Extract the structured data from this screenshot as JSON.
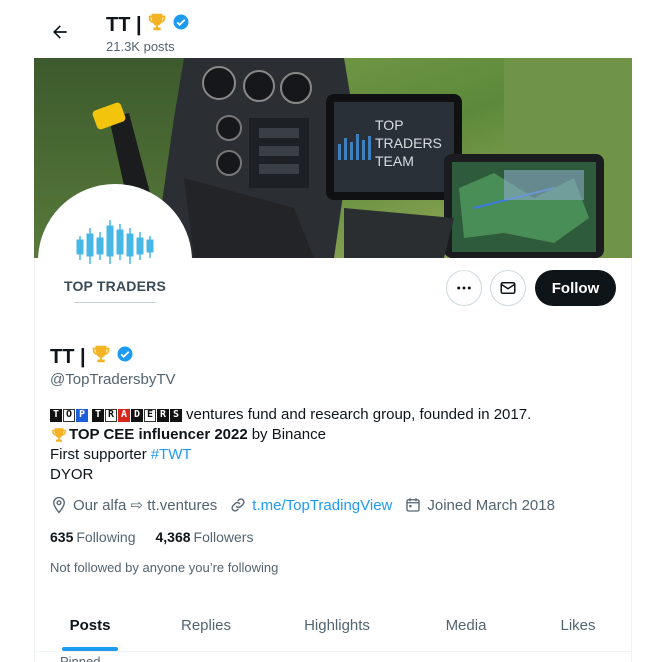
{
  "header": {
    "title": "TT |",
    "posts_count": "21.3K posts"
  },
  "banner": {
    "screen_text": [
      "TOP",
      "TRADERS",
      "TEAM"
    ]
  },
  "avatar": {
    "logo_text": "TOP TRADERS"
  },
  "actions": {
    "follow_label": "Follow"
  },
  "profile": {
    "name": "TT |",
    "handle": "@TopTradersbyTV",
    "verified": true,
    "bio": {
      "brand_word_1": "TOP",
      "brand_word_2": "TRADERS",
      "line1_text": "ventures fund and research group, founded in 2017.",
      "line2_bold": "TOP CEE influencer 2022",
      "line2_rest": "by Binance",
      "line3_text": "First supporter",
      "line3_hashtag": "#TWT",
      "line4_text": "DYOR"
    },
    "location": "Our alfa ⇨ tt.ventures",
    "website": "t.me/TopTradingView",
    "joined": "Joined March 2018",
    "following_count": "635",
    "following_label": "Following",
    "followers_count": "4,368",
    "followers_label": "Followers",
    "not_followed_text": "Not followed by anyone you’re following"
  },
  "tabs": [
    {
      "label": "Posts",
      "active": true
    },
    {
      "label": "Replies",
      "active": false
    },
    {
      "label": "Highlights",
      "active": false
    },
    {
      "label": "Media",
      "active": false
    },
    {
      "label": "Likes",
      "active": false
    }
  ],
  "next_row_text": "Pinned",
  "colors": {
    "accent": "#1d9bf0",
    "text": "#0f1419",
    "muted": "#536471",
    "follow_bg": "#0f1419",
    "trophy": "#f4b324"
  },
  "icons": [
    "back-arrow-icon",
    "trophy-icon",
    "verified-badge-icon",
    "more-icon",
    "mail-icon",
    "location-icon",
    "link-icon",
    "calendar-icon"
  ]
}
